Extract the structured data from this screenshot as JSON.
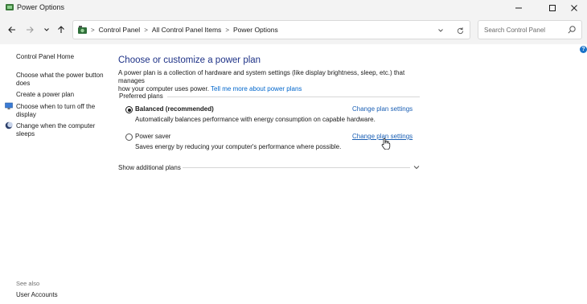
{
  "window": {
    "title": "Power Options"
  },
  "titlebar": {
    "icons": {
      "app": "power-options-app-icon",
      "minimize": "minimize-icon",
      "maximize": "maximize-icon",
      "close": "close-icon"
    }
  },
  "nav": {
    "back_icon": "back-arrow-icon",
    "forward_icon": "forward-arrow-icon",
    "recent_icon": "chevron-down-icon",
    "up_icon": "up-arrow-icon"
  },
  "address": {
    "crumbs": [
      "Control Panel",
      "All Control Panel Items",
      "Power Options"
    ],
    "separator": ">"
  },
  "search": {
    "placeholder": "Search Control Panel"
  },
  "leftpane": {
    "home": "Control Panel Home",
    "links": [
      {
        "label_line1": "Choose what the power button",
        "label_line2": "does"
      },
      {
        "label_line1": "Create a power plan"
      },
      {
        "label_line1": "Choose when to turn off the",
        "label_line2": "display",
        "icon": "monitor-icon"
      },
      {
        "label_line1": "Change when the computer",
        "label_line2": "sleeps",
        "icon": "moon-icon"
      }
    ],
    "see_also": "See also",
    "user_accounts": "User Accounts"
  },
  "main": {
    "title": "Choose or customize a power plan",
    "intro_line1": "A power plan is a collection of hardware and system settings (like display brightness, sleep, etc.) that manages",
    "intro_line2": "how your computer uses power.",
    "intro_link": "Tell me more about power plans",
    "preferred_label": "Preferred plans",
    "plans": [
      {
        "name": "Balanced (recommended)",
        "selected": true,
        "description": "Automatically balances performance with energy consumption on capable hardware.",
        "link": "Change plan settings"
      },
      {
        "name": "Power saver",
        "selected": false,
        "description": "Saves energy by reducing your computer's performance where possible.",
        "link": "Change plan settings"
      }
    ],
    "show_additional": "Show additional plans"
  },
  "help": {
    "label": "?"
  },
  "colors": {
    "title_blue": "#1e3287",
    "link_blue": "#1a5fb4",
    "help_blue": "#1a73c9"
  }
}
